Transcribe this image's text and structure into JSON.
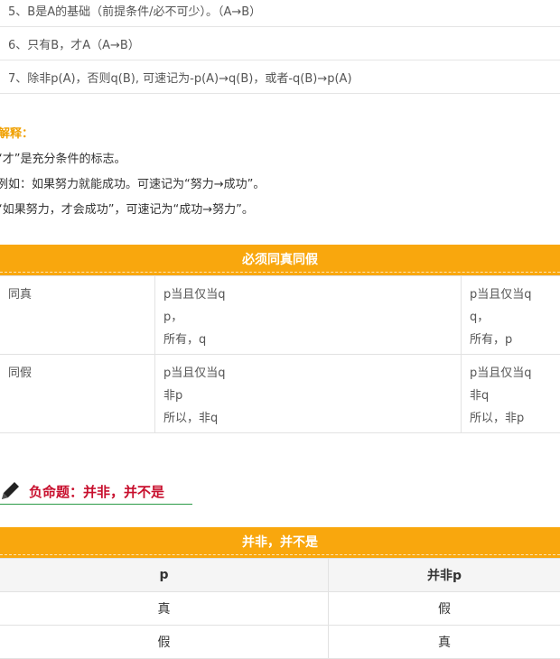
{
  "rules": [
    "5、B是A的基础（前提条件/必不可少）。（A→B）",
    "6、只有B，才A（A→B）",
    "7、除非p(A)，否则q(B), 可速记为-p(A)→q(B)，或者-q(B)→p(A)"
  ],
  "explanation": {
    "title": "解释：",
    "lines": [
      "“才”是充分条件的标志。",
      "例如：如果努力就能成功。可速记为“努力→成功”。",
      "“如果努力，才会成功”，可速记为“成功→努力”。"
    ]
  },
  "iff_table": {
    "header": "必须同真同假",
    "rows": [
      {
        "label": "同真",
        "col1": [
          "p当且仅当q",
          "p，",
          "所有，q"
        ],
        "col2": [
          "p当且仅当q",
          "q，",
          "所有，p"
        ]
      },
      {
        "label": "同假",
        "col1": [
          "p当且仅当q",
          "非p",
          "所以，非q"
        ],
        "col2": [
          "p当且仅当q",
          "非q",
          "所以，非p"
        ]
      }
    ]
  },
  "section": {
    "title": "负命题：并非，并不是",
    "icon": "pencil-icon"
  },
  "negation_table": {
    "header": "并非，并不是",
    "columns": [
      "p",
      "并非p"
    ],
    "rows": [
      [
        "真",
        "假"
      ],
      [
        "假",
        "真"
      ]
    ]
  },
  "colors": {
    "accent_bar": "#f9a70d",
    "explain_title": "#f0a000",
    "section_title": "#c8102e",
    "section_underline": "#2a9a46"
  }
}
